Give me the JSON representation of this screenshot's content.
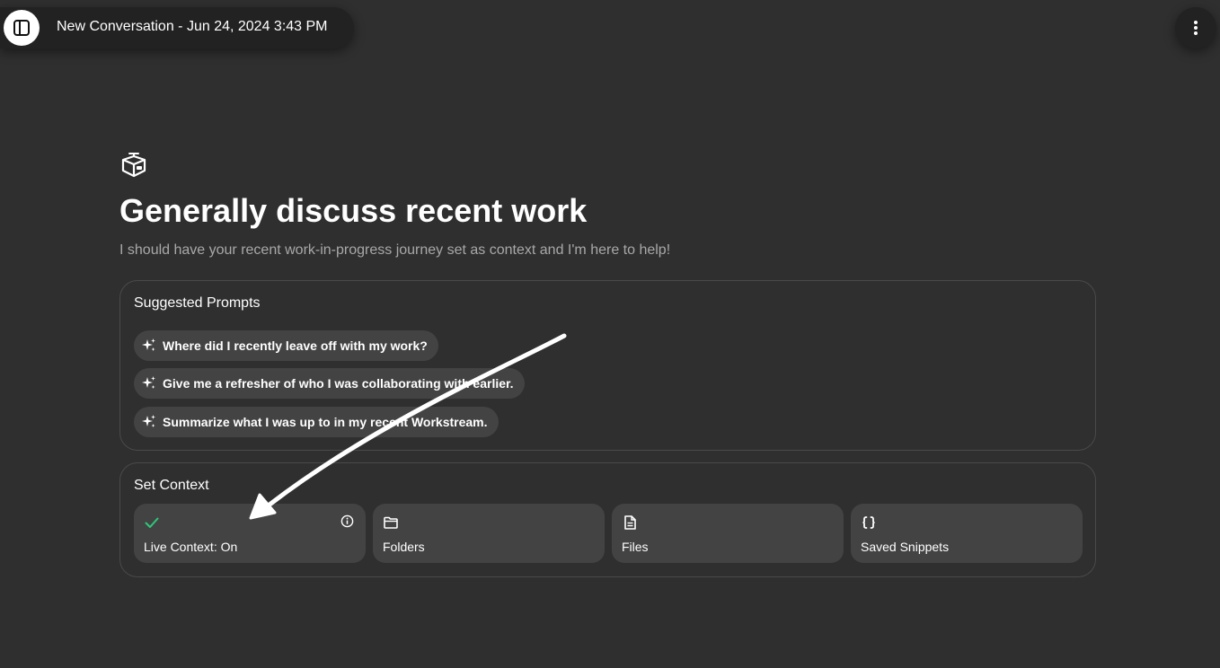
{
  "header": {
    "conversation_title": "New Conversation - Jun 24, 2024 3:43 PM",
    "sidebar_toggle_icon": "sidebar-panel-icon",
    "menu_icon": "more-vertical-icon"
  },
  "hero": {
    "icon": "box-bot-icon",
    "title": "Generally discuss recent work",
    "subtitle": "I should have your recent work-in-progress journey set as context and I'm here to help!"
  },
  "suggested_prompts": {
    "heading": "Suggested Prompts",
    "items": [
      {
        "label": "Where did I recently leave off with my work?",
        "icon": "sparkle-icon"
      },
      {
        "label": "Give me a refresher of who I was collaborating with earlier.",
        "icon": "sparkle-icon"
      },
      {
        "label": "Summarize what I was up to in my recent Workstream.",
        "icon": "sparkle-icon"
      }
    ]
  },
  "set_context": {
    "heading": "Set Context",
    "tiles": [
      {
        "label": "Live Context: On",
        "icon": "check-icon",
        "has_info": true
      },
      {
        "label": "Folders",
        "icon": "folder-icon"
      },
      {
        "label": "Files",
        "icon": "file-icon"
      },
      {
        "label": "Saved Snippets",
        "icon": "code-braces-icon"
      }
    ]
  },
  "colors": {
    "background": "#2f2f2f",
    "pill": "#222222",
    "chip": "#434343",
    "border": "#4a4a4a",
    "check": "#2ec97a",
    "subtitle": "#a8a8a8"
  }
}
